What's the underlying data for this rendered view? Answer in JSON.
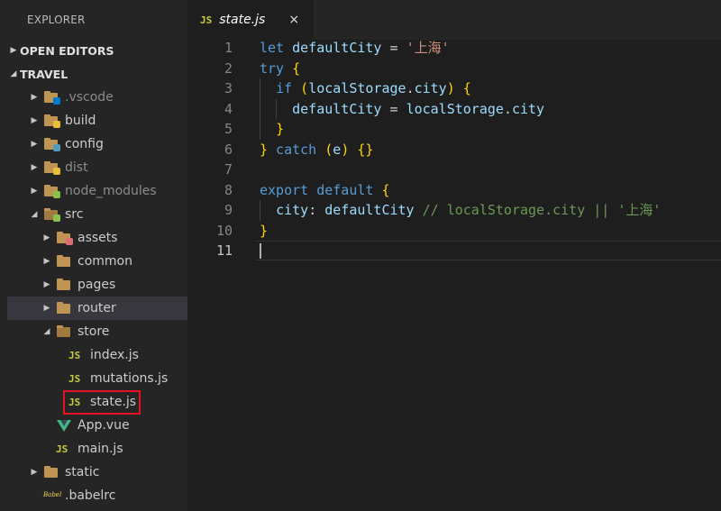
{
  "explorer": {
    "title": "EXPLORER",
    "open_editors": "OPEN EDITORS",
    "project": "TRAVEL"
  },
  "tree": [
    {
      "label": ".vscode",
      "kind": "folder",
      "badge": "#007acc",
      "dim": true
    },
    {
      "label": "build",
      "kind": "folder",
      "badge": "#e8c037",
      "dim": false
    },
    {
      "label": "config",
      "kind": "folder",
      "badge": "#519aba",
      "dim": false
    },
    {
      "label": "dist",
      "kind": "folder",
      "badge": "#e8c037",
      "dim": true
    },
    {
      "label": "node_modules",
      "kind": "folder",
      "badge": "#8bc34a",
      "dim": true
    },
    {
      "label": "src",
      "kind": "folder-open",
      "badge": "#8bc34a",
      "dim": false
    },
    {
      "label": "assets",
      "kind": "folder",
      "badge": "#e06c75",
      "dim": false
    },
    {
      "label": "common",
      "kind": "folder",
      "badge": "",
      "dim": false
    },
    {
      "label": "pages",
      "kind": "folder",
      "badge": "",
      "dim": false
    },
    {
      "label": "router",
      "kind": "folder",
      "badge": "",
      "dim": false,
      "selected": true
    },
    {
      "label": "store",
      "kind": "folder-open",
      "badge": "",
      "dim": false
    },
    {
      "label": "index.js",
      "kind": "js",
      "badge": "",
      "dim": false
    },
    {
      "label": "mutations.js",
      "kind": "js",
      "badge": "",
      "dim": false
    },
    {
      "label": "state.js",
      "kind": "js",
      "badge": "",
      "dim": false
    },
    {
      "label": "App.vue",
      "kind": "vue",
      "badge": "",
      "dim": false
    },
    {
      "label": "main.js",
      "kind": "js",
      "badge": "",
      "dim": false
    },
    {
      "label": "static",
      "kind": "folder",
      "badge": "",
      "dim": false
    },
    {
      "label": ".babelrc",
      "kind": "babel",
      "badge": "",
      "dim": false
    }
  ],
  "icons": {
    "js_glyph": "JS",
    "babel_glyph": "Babel",
    "close_glyph": "×"
  },
  "tab": {
    "label": "state.js"
  },
  "code": {
    "line_numbers": [
      "1",
      "2",
      "3",
      "4",
      "5",
      "6",
      "7",
      "8",
      "9",
      "10",
      "11"
    ],
    "active_line": 11,
    "lines": [
      [
        [
          "k",
          "let "
        ],
        [
          "v",
          "defaultCity"
        ],
        [
          "o",
          " = "
        ],
        [
          "s",
          "'上海'"
        ]
      ],
      [
        [
          "k",
          "try "
        ],
        [
          "p",
          "{"
        ]
      ],
      [
        [
          "o",
          "  "
        ],
        [
          "k",
          "if "
        ],
        [
          "p",
          "("
        ],
        [
          "v",
          "localStorage"
        ],
        [
          "o",
          "."
        ],
        [
          "v",
          "city"
        ],
        [
          "p",
          ")"
        ],
        [
          "o",
          " "
        ],
        [
          "p",
          "{"
        ]
      ],
      [
        [
          "o",
          "    "
        ],
        [
          "v",
          "defaultCity"
        ],
        [
          "o",
          " = "
        ],
        [
          "v",
          "localStorage"
        ],
        [
          "o",
          "."
        ],
        [
          "v",
          "city"
        ]
      ],
      [
        [
          "o",
          "  "
        ],
        [
          "p",
          "}"
        ]
      ],
      [
        [
          "p",
          "}"
        ],
        [
          "k",
          " catch "
        ],
        [
          "p",
          "("
        ],
        [
          "v",
          "e"
        ],
        [
          "p",
          ")"
        ],
        [
          "o",
          " "
        ],
        [
          "p",
          "{}"
        ]
      ],
      [],
      [
        [
          "k",
          "export default "
        ],
        [
          "p",
          "{"
        ]
      ],
      [
        [
          "o",
          "  "
        ],
        [
          "v",
          "city"
        ],
        [
          "o",
          ": "
        ],
        [
          "v",
          "defaultCity"
        ],
        [
          "c",
          " // localStorage.city || '上海'"
        ]
      ],
      [
        [
          "p",
          "}"
        ]
      ],
      []
    ]
  },
  "colors": {
    "sidebar_bg": "#252526",
    "editor_bg": "#1e1e1e",
    "highlight_box": "#e81123",
    "js_icon": "#cbcb41",
    "vue_icon": "#41b883"
  }
}
